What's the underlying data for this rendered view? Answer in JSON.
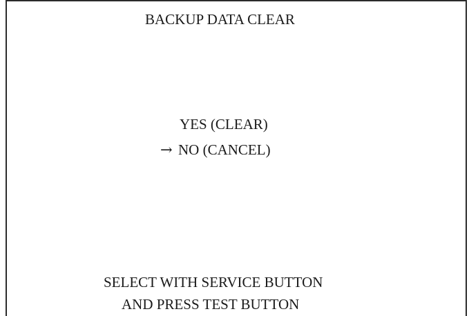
{
  "screen": {
    "title": "BACKUP DATA CLEAR",
    "options": [
      {
        "label": "YES (CLEAR)",
        "selected": false
      },
      {
        "label": "NO (CANCEL)",
        "selected": true
      }
    ],
    "cursor_symbol": "→",
    "instructions": [
      "SELECT WITH SERVICE BUTTON",
      "AND PRESS TEST BUTTON"
    ]
  }
}
